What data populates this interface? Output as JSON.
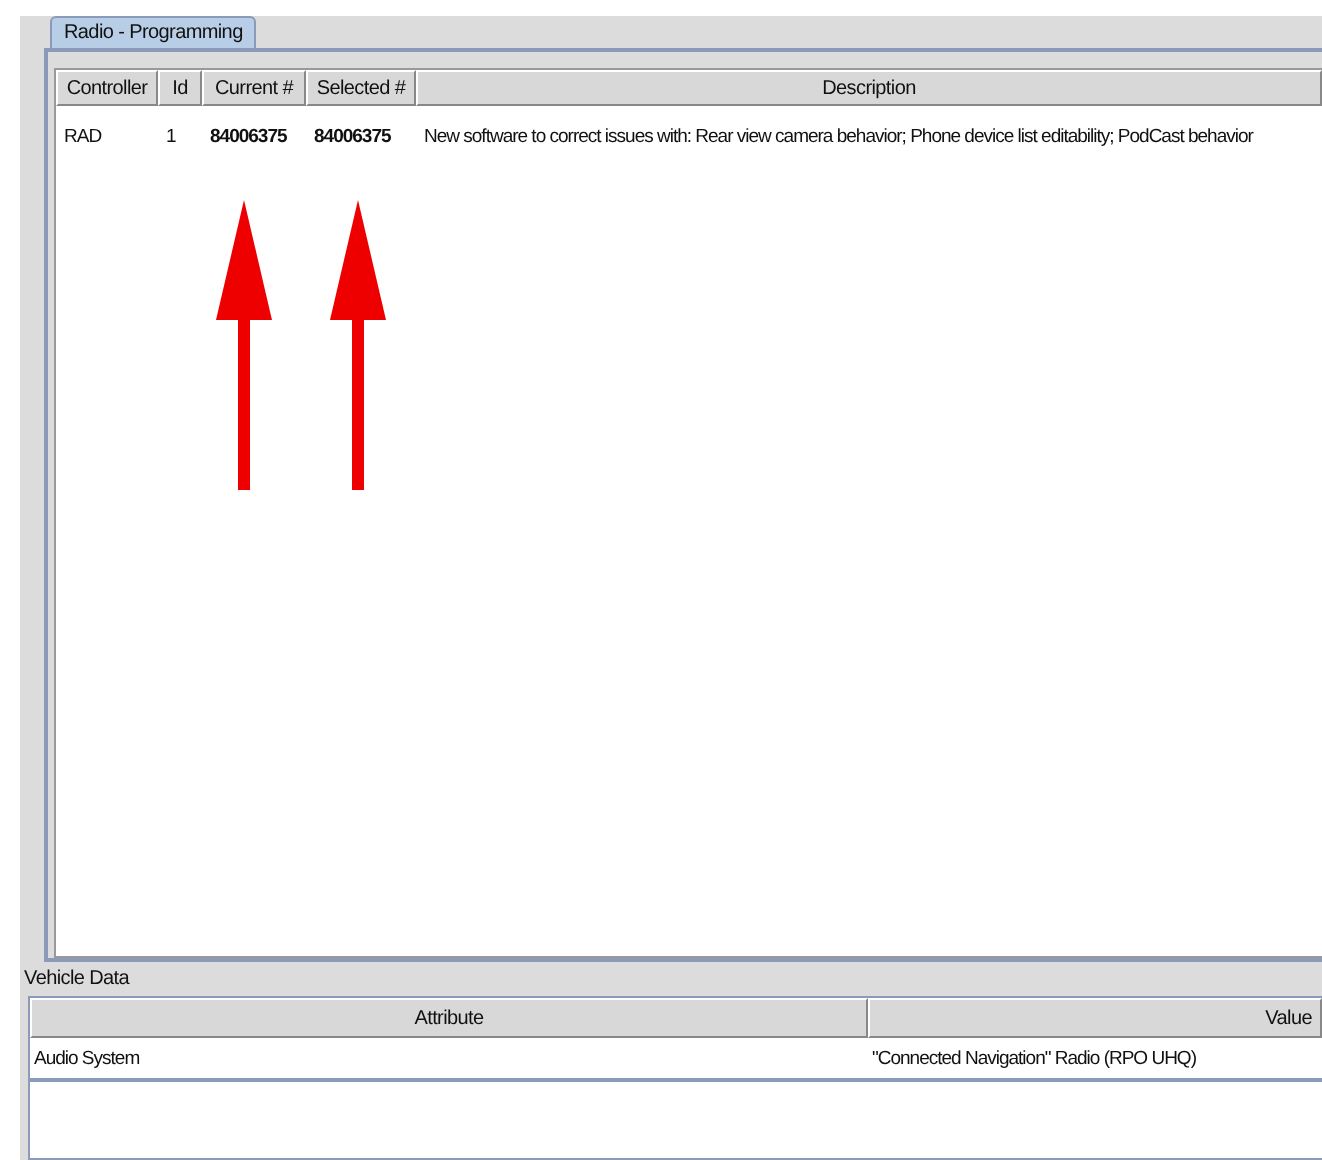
{
  "tabs": [
    {
      "label": "Radio - Programming",
      "selected": true
    }
  ],
  "programming_table": {
    "columns": [
      "Controller",
      "Id",
      "Current #",
      "Selected #",
      "Description"
    ],
    "rows": [
      {
        "cells": [
          "RAD",
          "1",
          "84006375",
          "84006375",
          "New software to correct issues with: Rear view camera behavior; Phone device list editability; PodCast behavior"
        ]
      }
    ]
  },
  "vehicle_data": {
    "title": "Vehicle Data",
    "columns": [
      "Attribute",
      "Value"
    ],
    "rows": [
      {
        "cells": [
          "Audio System",
          "\"Connected Navigation\" Radio (RPO UHQ)"
        ]
      }
    ]
  }
}
